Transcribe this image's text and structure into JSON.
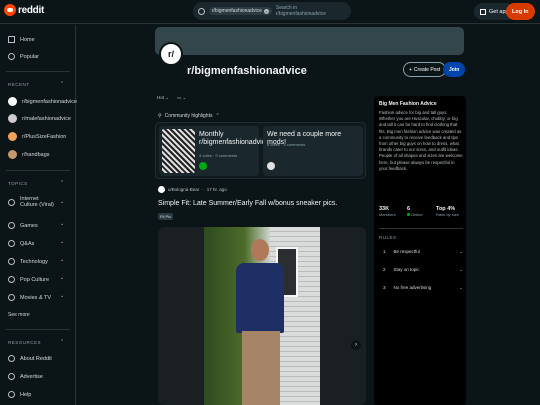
{
  "header": {
    "logo_text": "reddit",
    "search_chip": "r/bigmenfashionadvice",
    "search_placeholder": "Search in r/bigmenfashionadvice",
    "get_app": "Get app",
    "login": "Log In"
  },
  "sidebar": {
    "nav": [
      {
        "label": "Home",
        "icon": "home-icon"
      },
      {
        "label": "Popular",
        "icon": "popular-icon"
      }
    ],
    "recent_header": "RECENT",
    "recent": [
      {
        "label": "r/bigmenfashionadvice",
        "color": "#ffffff"
      },
      {
        "label": "r/malefashionadvice",
        "color": "#cccccc"
      },
      {
        "label": "r/PlusSizeFashion",
        "color": "#f4a259"
      },
      {
        "label": "r/handbags",
        "color": "#c49a6c"
      }
    ],
    "topics_header": "TOPICS",
    "topics": [
      {
        "label": "Internet Culture (Viral)"
      },
      {
        "label": "Games"
      },
      {
        "label": "Q&As"
      },
      {
        "label": "Technology"
      },
      {
        "label": "Pop Culture"
      },
      {
        "label": "Movies & TV"
      }
    ],
    "see_more": "See more",
    "resources_header": "RESOURCES",
    "resources": [
      {
        "label": "About Reddit"
      },
      {
        "label": "Advertise"
      },
      {
        "label": "Help"
      }
    ]
  },
  "subreddit": {
    "icon_text": "r/",
    "name": "r/bigmenfashionadvice",
    "create_post": "Create Post",
    "join": "Join"
  },
  "feed": {
    "sort_label": "Hot",
    "highlights_label": "Community highlights",
    "highlights": [
      {
        "title": "Monthly r/bigmenfashionadvic...",
        "meta": "4 votes · 0 comments"
      },
      {
        "title": "We need a couple more mods!",
        "meta": "6 votes · 4 comments"
      }
    ],
    "post": {
      "author": "u/Bologna-Bear",
      "age": "17 hr. ago",
      "title": "Simple Fit: Late Summer/Early Fall w/bonus sneaker pics.",
      "flair": "Fit Pic"
    }
  },
  "about": {
    "title": "Big Men Fashion Advice",
    "description": "Fashion advice for big and tall guys. Whether you are Huscular, chubby, or big and tall it can be hard to find clothing that fits. Big men fashion advice was created as a community to receive feedback and tips from other big guys on how to dress, what brands cater to our sizes, and outfit ideas. People of all shapes and sizes are welcome here, but please always be respectful in your feedback.",
    "stats": [
      {
        "value": "33K",
        "label": "Members"
      },
      {
        "value": "6",
        "label": "Online"
      },
      {
        "value": "Top 4%",
        "label": "Rank by size"
      }
    ],
    "rules_header": "RULES",
    "rules": [
      {
        "num": "1",
        "text": "Be respectful"
      },
      {
        "num": "2",
        "text": "Stay on topic"
      },
      {
        "num": "3",
        "text": "No free advertising"
      }
    ]
  },
  "colors": {
    "background": "#0b1416",
    "accent": "#ff4500",
    "join": "#0045ac"
  }
}
